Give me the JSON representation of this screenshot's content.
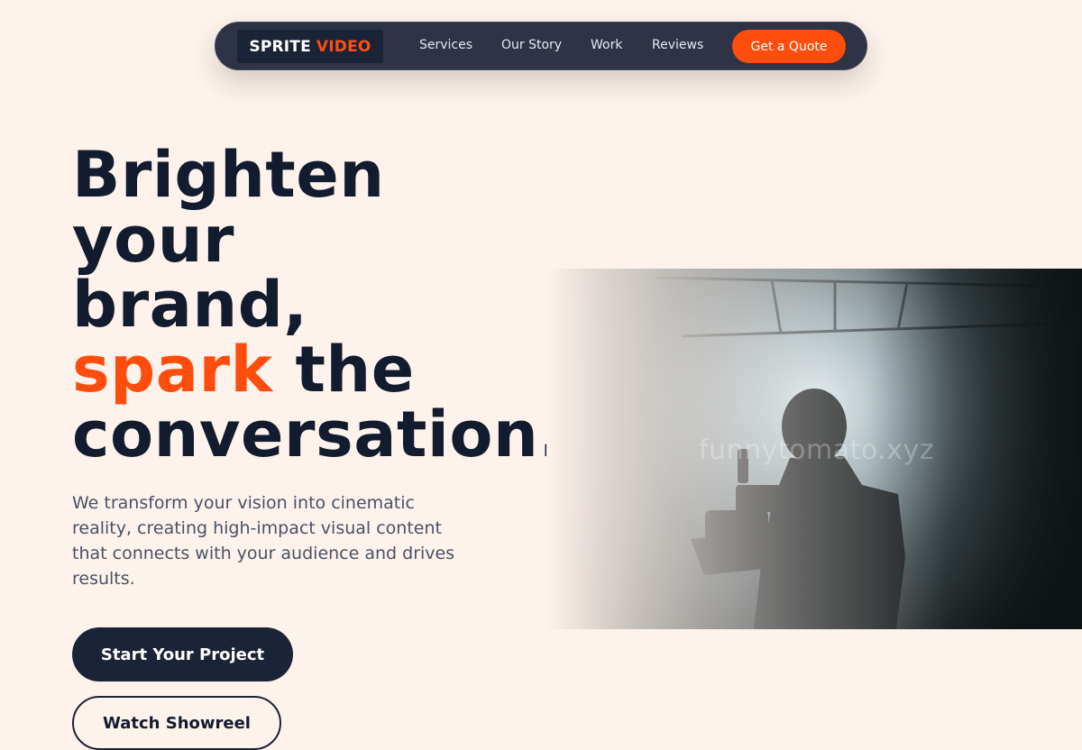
{
  "nav": {
    "logo_word1": "SPRITE",
    "logo_word2": "VIDEO",
    "links": [
      "Services",
      "Our Story",
      "Work",
      "Reviews"
    ],
    "cta_label": "Get a Quote"
  },
  "hero": {
    "headline_lines": [
      "Brighten",
      "your",
      "brand,"
    ],
    "headline_accent": "spark",
    "headline_after_accent": " the",
    "headline_last": "conversation.",
    "subtext": "We transform your vision into cinematic reality, creating high-impact visual content that connects with your audience and drives results.",
    "primary_cta": "Start Your Project",
    "secondary_cta": "Watch Showreel",
    "image_watermark": "funnytomato.xyz"
  },
  "colors": {
    "background": "#fdf3ec",
    "navy": "#1b2336",
    "accent": "#ff4d0d",
    "body_text": "#4a5166"
  }
}
